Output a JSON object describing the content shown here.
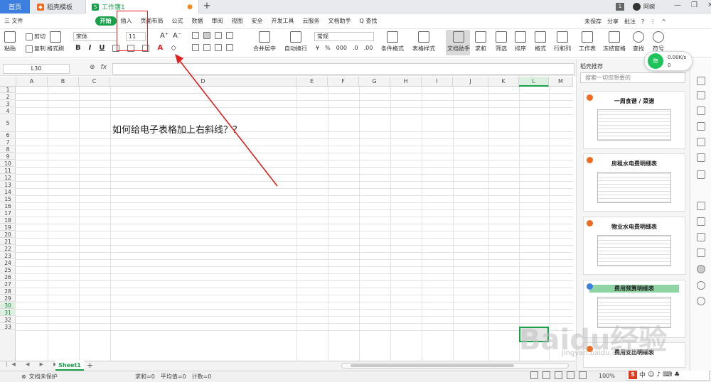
{
  "tabs": {
    "home": "首页",
    "template": "稻壳模板",
    "document": "工作簿1",
    "new_tab": "+"
  },
  "titlebar": {
    "page_count": "1",
    "user_name": "阿婉"
  },
  "menu": {
    "file": "三 文件",
    "items": [
      "开始",
      "插入",
      "页面布局",
      "公式",
      "数据",
      "审阅",
      "视图",
      "安全",
      "开发工具",
      "云服务",
      "文档助手"
    ],
    "search": "Q 查找",
    "unsaved": "未保存",
    "share": "分享",
    "comment": "批注"
  },
  "ribbon": {
    "paste": "粘贴",
    "cut": "剪切",
    "copy": "复制",
    "format_painter": "格式刷",
    "font_name": "宋体",
    "font_size": "11",
    "merge": "合并居中",
    "wrap": "自动换行",
    "number_format": "常规",
    "cond_format": "条件格式",
    "table_style": "表格样式",
    "doc_assistant": "文档助手",
    "sum": "求和",
    "filter": "筛选",
    "sort": "排序",
    "format": "格式",
    "rowcol": "行和列",
    "worksheet": "工作表",
    "freeze": "冻结窗格",
    "find": "查找",
    "symbol": "符号"
  },
  "formula_bar": {
    "name_box": "L30",
    "fx": "fx"
  },
  "columns": [
    "A",
    "B",
    "C",
    "D",
    "E",
    "F",
    "G",
    "H",
    "I",
    "J",
    "K",
    "L",
    "M"
  ],
  "rows": [
    "1",
    "2",
    "3",
    "4",
    "5",
    "6",
    "7",
    "8",
    "9",
    "10",
    "11",
    "12",
    "13",
    "14",
    "15",
    "16",
    "17",
    "18",
    "19",
    "20",
    "21",
    "22",
    "23",
    "24",
    "25",
    "26",
    "27",
    "28",
    "29",
    "30",
    "31",
    "32",
    "33"
  ],
  "cell_text": "如何给电子表格加上右斜线？？",
  "sheet_tab": "Sheet1",
  "status": {
    "protect": "文档未保护",
    "sum": "求和=0",
    "avg": "平均值=0",
    "count": "计数=0",
    "zoom": "100%"
  },
  "panel": {
    "title": "稻壳推荐",
    "search_placeholder": "搜索一切您想要的",
    "cards": [
      "一周食谱 / 菜谱",
      "房租水电费明细表",
      "物业水电费明细表",
      "费用预算明细表",
      "费用支出明细表"
    ]
  },
  "network": {
    "up": "0.00K/s",
    "down": "0"
  },
  "watermark": {
    "main": "Baidu经验",
    "sub": "jingyan.baidu.com"
  },
  "ime": {
    "label": "中"
  },
  "colors": {
    "accent": "#1aa04a",
    "home_tab": "#3d7fe0",
    "annotation": "#e02020"
  }
}
